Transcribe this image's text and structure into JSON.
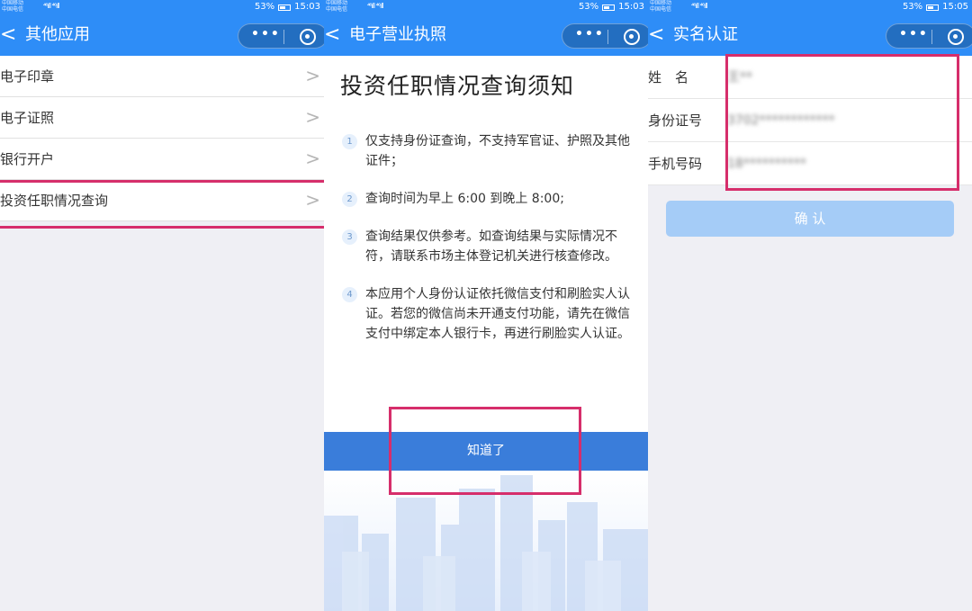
{
  "status": {
    "carrier_top": "中国移动",
    "carrier_bottom": "中国电信",
    "signal": "⁴⁶ıll ⁴⁶ıll",
    "battery_pct": "53%",
    "time": "15:03",
    "time_right": "15:05"
  },
  "panel1": {
    "title": "其他应用",
    "items": [
      {
        "label": "电子印章"
      },
      {
        "label": "电子证照"
      },
      {
        "label": "银行开户"
      },
      {
        "label": "投资任职情况查询"
      }
    ],
    "chevron": ">"
  },
  "panel2": {
    "title": "电子营业执照",
    "notice_title": "投资任职情况查询须知",
    "items": [
      {
        "num": "1",
        "text": "仅支持身份证查询，不支持军官证、护照及其他证件；"
      },
      {
        "num": "2",
        "text": "查询时间为早上 6:00 到晚上 8:00;"
      },
      {
        "num": "3",
        "text": "查询结果仅供参考。如查询结果与实际情况不符，请联系市场主体登记机关进行核查修改。"
      },
      {
        "num": "4",
        "text": "本应用个人身份认证依托微信支付和刷脸实人认证。若您的微信尚未开通支付功能，请先在微信支付中绑定本人银行卡，再进行刷脸实人认证。"
      }
    ],
    "button": "知道了"
  },
  "panel3": {
    "title": "实名认证",
    "fields": [
      {
        "label": "姓　名",
        "value": "王**"
      },
      {
        "label": "身份证号",
        "value": "3702************"
      },
      {
        "label": "手机号码",
        "value": "18**********"
      }
    ],
    "confirm": "确 认"
  },
  "nav": {
    "back": "<",
    "more": "•••"
  },
  "colors": {
    "navbar": "#2e8df7",
    "highlight": "#d62e6b",
    "button": "#3a7dda",
    "confirm_disabled": "#a5ccf7"
  }
}
